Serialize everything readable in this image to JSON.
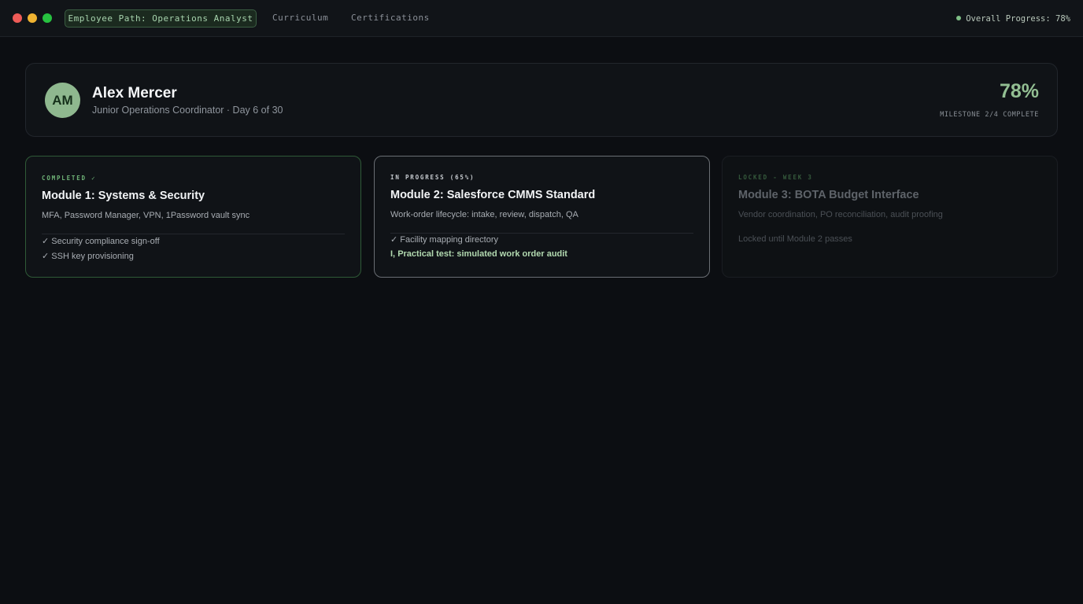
{
  "window": {
    "tabs": [
      {
        "label": "Employee Path: Operations Analyst",
        "active": true
      },
      {
        "label": "Curriculum",
        "active": false
      },
      {
        "label": "Certifications",
        "active": false
      }
    ],
    "overall_progress": "Overall Progress: 78%"
  },
  "profile": {
    "initials": "AM",
    "name": "Alex Mercer",
    "role": "Junior Operations Coordinator · Day 6 of 30",
    "percent": "78%",
    "milestone": "MILESTONE 2/4 COMPLETE"
  },
  "modules": [
    {
      "status": "COMPLETED ✓",
      "title": "Module 1: Systems & Security",
      "description": "MFA, Password Manager, VPN, 1Password vault sync",
      "items": [
        "✓ Security compliance sign-off",
        "✓ SSH key provisioning"
      ]
    },
    {
      "status": "IN PROGRESS (65%)",
      "progress_percent": 65,
      "title": "Module 2: Salesforce CMMS Standard",
      "description": "Work-order lifecycle: intake, review, dispatch, QA",
      "items": [
        "✓ Facility mapping directory",
        "Practical test: simulated work order audit"
      ],
      "active_marker": "I,"
    },
    {
      "status": "LOCKED - WEEK 3",
      "title": "Module 3: BOTA Budget Interface",
      "description": "Vendor coordination, PO reconciliation, audit proofing",
      "items": [
        "Locked until Module 2 passes"
      ]
    }
  ],
  "colors": {
    "background": "#0c0e12",
    "accent_green": "#93bf93",
    "completed_border": "#2f5a37",
    "active_border": "#6a6e74"
  }
}
